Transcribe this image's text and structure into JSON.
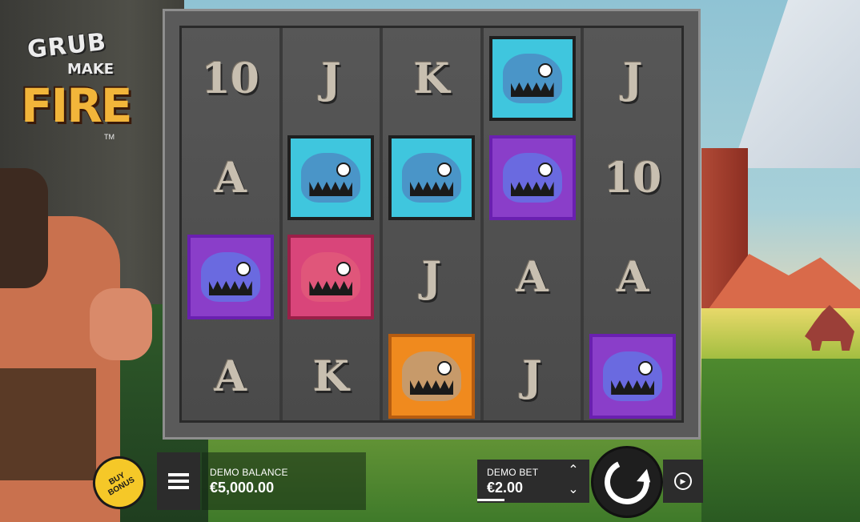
{
  "game": {
    "logo": {
      "line1": "GRUB",
      "line2": "MAKE",
      "line3": "FIRE",
      "tm": "TM"
    }
  },
  "colors": {
    "board": "#5a5a5a",
    "accent_buy": "#f5c828",
    "panel": "#2c2c2c"
  },
  "reels": [
    [
      "10",
      "A",
      "purple-dino",
      "A"
    ],
    [
      "J",
      "blue-shark",
      "red-raptor",
      "K"
    ],
    [
      "K",
      "blue-shark",
      "J",
      "bear"
    ],
    [
      "blue-shark",
      "purple-dino",
      "A",
      "J"
    ],
    [
      "J",
      "10",
      "A",
      "purple-dino"
    ]
  ],
  "controls": {
    "buy_bonus": {
      "line1": "BUY",
      "line2": "BONUS"
    },
    "balance": {
      "label": "DEMO BALANCE",
      "value": "€5,000.00"
    },
    "bet": {
      "label": "DEMO BET",
      "value": "€2.00"
    },
    "icons": {
      "menu": "menu-icon",
      "bet_up": "chevron-up-icon",
      "bet_down": "chevron-down-icon",
      "spin": "spin-icon",
      "autoplay": "autoplay-icon"
    }
  }
}
